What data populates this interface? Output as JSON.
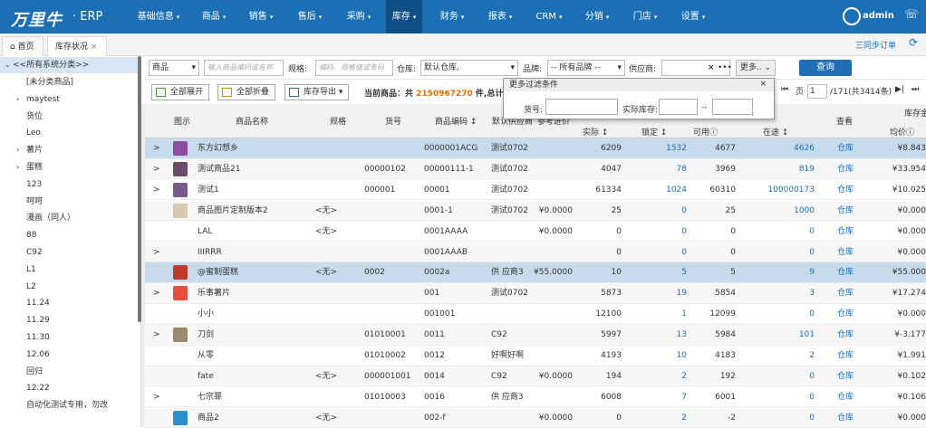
{
  "brand": {
    "logo": "万里牛",
    "suffix": "· ERP"
  },
  "nav": [
    {
      "label": "基础信息",
      "caret": true
    },
    {
      "label": "商品",
      "caret": true
    },
    {
      "label": "销售",
      "caret": true
    },
    {
      "label": "售后",
      "caret": true
    },
    {
      "label": "采购",
      "caret": true
    },
    {
      "label": "库存",
      "caret": true,
      "active": true
    },
    {
      "label": "财务",
      "caret": true
    },
    {
      "label": "报表",
      "caret": true
    },
    {
      "label": "CRM",
      "caret": true
    },
    {
      "label": "分销",
      "caret": true
    },
    {
      "label": "门店",
      "caret": true
    },
    {
      "label": "设置",
      "caret": true
    }
  ],
  "user": {
    "name": "admin"
  },
  "tabs": [
    {
      "label": "首页"
    },
    {
      "label": "库存状况",
      "close": "×"
    }
  ],
  "sync_label": "三同步订单",
  "sidebar": {
    "root": "<<所有系统分类>>",
    "items": [
      {
        "label": "[未分类商品]",
        "arrow": false
      },
      {
        "label": "maytest",
        "arrow": true
      },
      {
        "label": "货位",
        "arrow": false
      },
      {
        "label": "Leo",
        "arrow": false
      },
      {
        "label": "薯片",
        "arrow": true
      },
      {
        "label": "蛋糕",
        "arrow": true
      },
      {
        "label": "123",
        "arrow": false
      },
      {
        "label": "呵呵",
        "arrow": false
      },
      {
        "label": "漫画（同人）",
        "arrow": false
      },
      {
        "label": "88",
        "arrow": false
      },
      {
        "label": "C92",
        "arrow": false
      },
      {
        "label": "L1",
        "arrow": false
      },
      {
        "label": "L2",
        "arrow": false
      },
      {
        "label": "11.24",
        "arrow": false
      },
      {
        "label": "11.29",
        "arrow": false
      },
      {
        "label": "11.30",
        "arrow": false
      },
      {
        "label": "12.06",
        "arrow": false
      },
      {
        "label": "回归",
        "arrow": false
      },
      {
        "label": "12.22",
        "arrow": false
      },
      {
        "label": "自动化测试专用，勿改",
        "arrow": false
      }
    ]
  },
  "filter": {
    "type_select": "商品",
    "name_placeholder": "输入商品编码或名称",
    "spec_label": "规格:",
    "spec_placeholder": "编码、规格值或条码",
    "warehouse_label": "仓库:",
    "warehouse_value": "默认仓库,",
    "brand_label": "品牌:",
    "brand_value": "-- 所有品牌 --",
    "supplier_label": "供应商:",
    "supplier_clear": "×",
    "supplier_more": "•••",
    "more_label": "更多..",
    "query_label": "查询"
  },
  "toolbar": {
    "expand": "全部展开",
    "collapse": "全部折叠",
    "export": "库存导出"
  },
  "summary": {
    "prefix": "当前商品：共",
    "count": "2150967270",
    "suffix": "件,总计"
  },
  "pager": {
    "page": "1",
    "total": "/171(共3414条)"
  },
  "popup": {
    "title": "更多过滤条件",
    "close": "×",
    "sku_label": "货号:",
    "stock_label": "实际库存:",
    "range_sep": "--"
  },
  "columns": {
    "image": "图示",
    "name": "商品名称",
    "spec": "规格",
    "sku": "货号",
    "code": "商品编码 ↕",
    "cat": "默认供应商",
    "cost": "参考进价",
    "actual": "实际 ↕",
    "locked": "锁定 ↕",
    "avail": "可用ⓘ",
    "transit": "在途 ↕",
    "view": "查看",
    "stock_group": "库存金",
    "avg": "均价ⓘ"
  },
  "rows": [
    {
      "expand": ">",
      "thumb": "#8a4fa0",
      "name": "东方幻想乡",
      "spec": "",
      "sku": "",
      "code": "0000001ACG",
      "cat": "测试0702",
      "cost": "",
      "actual": "6209",
      "locked": "1532",
      "avail": "4677",
      "transit": "4626",
      "view": "仓库",
      "avg": "¥8.843"
    },
    {
      "expand": ">",
      "thumb": "#6b4a6a",
      "name": "测试商品21",
      "spec": "",
      "sku": "00000102",
      "code": "00000111-1",
      "cat": "测试0702",
      "cost": "",
      "actual": "4047",
      "locked": "78",
      "avail": "3969",
      "transit": "819",
      "view": "仓库",
      "avg": "¥33.954"
    },
    {
      "expand": ">",
      "thumb": "#7a5a8a",
      "name": "测试1",
      "spec": "",
      "sku": "000001",
      "code": "00001",
      "cat": "测试0702",
      "cost": "",
      "actual": "61334",
      "locked": "1024",
      "avail": "60310",
      "transit": "100000173",
      "view": "仓库",
      "avg": "¥10.025"
    },
    {
      "expand": "",
      "thumb": "#d8c8b0",
      "name": "商品图片定制版本2",
      "spec": "<无>",
      "sku": "",
      "code": "0001-1",
      "cat": "测试0702",
      "cost": "¥0.0000",
      "actual": "25",
      "locked": "0",
      "avail": "25",
      "transit": "1000",
      "view": "仓库",
      "avg": "¥0.000"
    },
    {
      "expand": "",
      "thumb": "",
      "name": "LAL",
      "spec": "<无>",
      "sku": "",
      "code": "0001AAAA",
      "cat": "",
      "cost": "¥0.0000",
      "actual": "0",
      "locked": "0",
      "avail": "0",
      "transit": "0",
      "view": "仓库",
      "avg": "¥0.000"
    },
    {
      "expand": ">",
      "thumb": "",
      "name": "IIIRRR",
      "spec": "",
      "sku": "",
      "code": "0001AAAB",
      "cat": "",
      "cost": "",
      "actual": "0",
      "locked": "0",
      "avail": "0",
      "transit": "0",
      "view": "仓库",
      "avg": "¥0.000"
    },
    {
      "expand": "",
      "thumb": "#c0392b",
      "name": "@蜜制蛋糕",
      "spec": "<无>",
      "sku": "0002",
      "code": "0002a",
      "cat": "供 应商3",
      "cost": "¥55.0000",
      "actual": "10",
      "locked": "5",
      "avail": "5",
      "transit": "9",
      "view": "仓库",
      "avg": "¥55.000"
    },
    {
      "expand": ">",
      "thumb": "#e74c3c",
      "name": "乐事薯片",
      "spec": "",
      "sku": "",
      "code": "001",
      "cat": "测试0702",
      "cost": "",
      "actual": "5873",
      "locked": "19",
      "avail": "5854",
      "transit": "3",
      "view": "仓库",
      "avg": "¥17.274"
    },
    {
      "expand": "",
      "thumb": "",
      "name": "小小",
      "spec": "",
      "sku": "",
      "code": "001001",
      "cat": "",
      "cost": "",
      "actual": "12100",
      "locked": "1",
      "avail": "12099",
      "transit": "0",
      "view": "仓库",
      "avg": "¥0.000"
    },
    {
      "expand": ">",
      "thumb": "#9a8a70",
      "name": "刀剑",
      "spec": "",
      "sku": "01010001",
      "code": "0011",
      "cat": "C92",
      "cost": "",
      "actual": "5997",
      "locked": "13",
      "avail": "5984",
      "transit": "101",
      "view": "仓库",
      "avg": "¥-3.177"
    },
    {
      "expand": "",
      "thumb": "",
      "name": "从零",
      "spec": "",
      "sku": "01010002",
      "code": "0012",
      "cat": "好啊好啊",
      "cost": "",
      "actual": "4193",
      "locked": "10",
      "avail": "4183",
      "transit": "2",
      "view": "仓库",
      "avg": "¥1.991"
    },
    {
      "expand": "",
      "thumb": "",
      "name": "fate",
      "spec": "<无>",
      "sku": "000001001",
      "code": "0014",
      "cat": "C92",
      "cost": "¥0.0000",
      "actual": "194",
      "locked": "2",
      "avail": "192",
      "transit": "0",
      "view": "仓库",
      "avg": "¥0.102"
    },
    {
      "expand": ">",
      "thumb": "",
      "name": "七宗罪",
      "spec": "",
      "sku": "01010003",
      "code": "0016",
      "cat": "供 应商3",
      "cost": "",
      "actual": "6008",
      "locked": "7",
      "avail": "6001",
      "transit": "0",
      "view": "仓库",
      "avg": "¥0.106"
    },
    {
      "expand": "",
      "thumb": "#2c8fc9",
      "name": "商品2",
      "spec": "<无>",
      "sku": "",
      "code": "002-f",
      "cat": "",
      "cost": "¥0.0000",
      "actual": "0",
      "locked": "2",
      "avail": "-2",
      "transit": "0",
      "view": "仓库",
      "avg": "¥0.000"
    }
  ]
}
